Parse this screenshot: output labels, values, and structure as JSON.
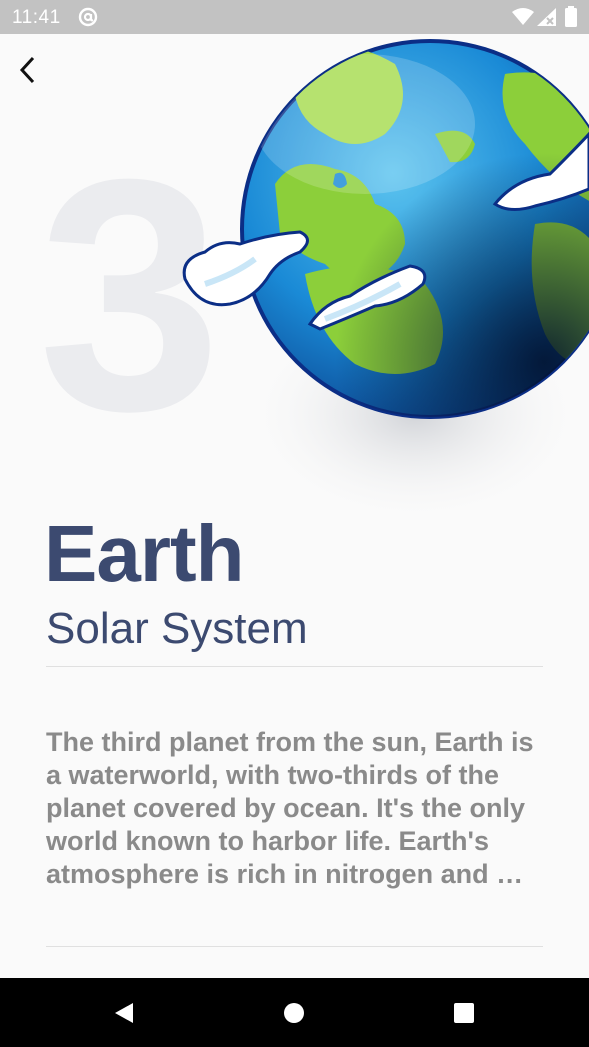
{
  "status_bar": {
    "time": "11:41",
    "icons": [
      "at-sign-icon",
      "wifi-icon",
      "signal-icon",
      "battery-icon"
    ]
  },
  "header": {
    "back_icon": "chevron-left-icon"
  },
  "planet": {
    "number": "3",
    "name": "Earth",
    "category": "Solar System",
    "description": "The third planet from the sun, Earth is a waterworld, with two-thirds of the planet covered by ocean. It's the only world known to harbor life. Earth's atmosphere is rich in nitrogen and …",
    "image": "earth-illustration"
  },
  "colors": {
    "title": "#3c4a70",
    "body": "#8a8a8a",
    "ocean": "#1c8fd6",
    "land": "#8ccf3a",
    "status_bar": "#c2c2c2"
  },
  "nav_bar": {
    "buttons": [
      "back-triangle-icon",
      "home-circle-icon",
      "recents-square-icon"
    ]
  }
}
